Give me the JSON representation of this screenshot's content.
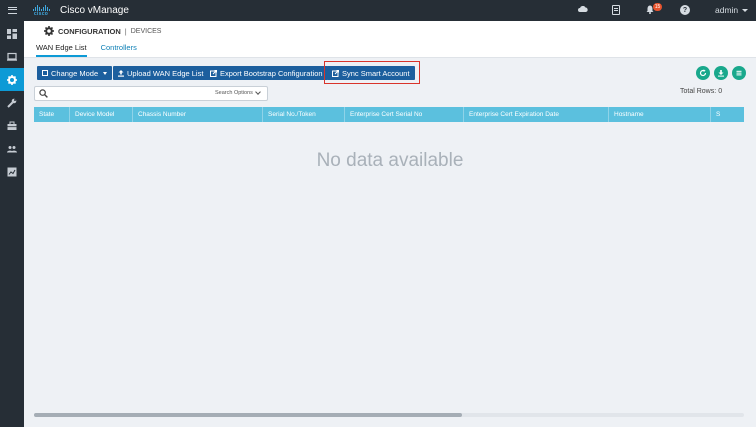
{
  "app": {
    "title": "Cisco vManage",
    "logo_text": "cisco"
  },
  "topbar": {
    "icons": [
      "menu-icon",
      "cloud-icon",
      "document-icon",
      "bell-icon",
      "help-icon"
    ],
    "notification_count": "15",
    "help_label": "?",
    "user": "admin"
  },
  "sidebar": {
    "items": [
      {
        "name": "dashboard",
        "icon": "dashboard-icon"
      },
      {
        "name": "monitor",
        "icon": "monitor-icon"
      },
      {
        "name": "configuration",
        "icon": "gear-icon",
        "active": true
      },
      {
        "name": "tools",
        "icon": "wrench-icon"
      },
      {
        "name": "maintenance",
        "icon": "toolbox-icon"
      },
      {
        "name": "administration",
        "icon": "users-icon"
      },
      {
        "name": "analytics",
        "icon": "chart-icon"
      }
    ]
  },
  "header": {
    "section": "CONFIGURATION",
    "separator": "|",
    "page": "DEVICES",
    "tabs": [
      {
        "label": "WAN Edge List",
        "active": true
      },
      {
        "label": "Controllers",
        "active": false
      }
    ]
  },
  "toolbar": {
    "change_mode": "Change Mode",
    "upload": "Upload WAN Edge List",
    "export": "Export Bootstrap Configuration",
    "sync": "Sync Smart Account",
    "action_icons": [
      "refresh-icon",
      "download-icon",
      "list-icon"
    ]
  },
  "search": {
    "placeholder": "",
    "options_label": "Search Options"
  },
  "table": {
    "total_rows_label": "Total Rows:",
    "total_rows": "0",
    "columns": [
      "State",
      "Device Model",
      "Chassis Number",
      "Serial No./Token",
      "Enterprise Cert Serial No",
      "Enterprise Cert Expiration Date",
      "Hostname",
      "S"
    ],
    "empty_message": "No data available"
  },
  "colors": {
    "topbar_bg": "#262e36",
    "accent": "#0d9ad6",
    "button_bg": "#1c5f9e",
    "table_header": "#5bc0de",
    "round_button": "#19a88c",
    "highlight": "#d9342b"
  }
}
